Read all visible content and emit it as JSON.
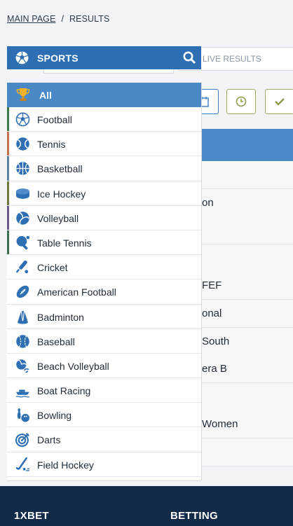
{
  "breadcrumb": {
    "home": "MAIN PAGE",
    "separator": "/",
    "current": "RESULTS"
  },
  "header": {
    "title": "SPORTS"
  },
  "search": {
    "placeholder": "LIVE RESULTS"
  },
  "menu": {
    "all_label": "All",
    "items": [
      {
        "label": "Football",
        "icon": "football-icon",
        "accent": "#3b7a4a"
      },
      {
        "label": "Tennis",
        "icon": "tennis-ball-icon",
        "accent": "#c0704a"
      },
      {
        "label": "Basketball",
        "icon": "basketball-icon",
        "accent": "#5b7f9e"
      },
      {
        "label": "Ice Hockey",
        "icon": "hockey-puck-icon",
        "accent": "#6b7a3c"
      },
      {
        "label": "Volleyball",
        "icon": "volleyball-icon",
        "accent": "#6a5a8e"
      },
      {
        "label": "Table Tennis",
        "icon": "table-tennis-icon",
        "accent": "#3d6e4e"
      },
      {
        "label": "Cricket",
        "icon": "cricket-bat-icon",
        "accent": ""
      },
      {
        "label": "American Football",
        "icon": "american-football-icon",
        "accent": ""
      },
      {
        "label": "Badminton",
        "icon": "shuttlecock-icon",
        "accent": ""
      },
      {
        "label": "Baseball",
        "icon": "baseball-icon",
        "accent": ""
      },
      {
        "label": "Beach Volleyball",
        "icon": "beach-volleyball-icon",
        "accent": ""
      },
      {
        "label": "Boat Racing",
        "icon": "boat-icon",
        "accent": ""
      },
      {
        "label": "Bowling",
        "icon": "bowling-icon",
        "accent": ""
      },
      {
        "label": "Darts",
        "icon": "darts-icon",
        "accent": ""
      },
      {
        "label": "Field Hockey",
        "icon": "field-hockey-icon",
        "accent": ""
      }
    ]
  },
  "background_rows": [
    {
      "text": ""
    },
    {
      "text": "on"
    },
    {
      "text": ""
    },
    {
      "text": ""
    },
    {
      "text": "FEF"
    },
    {
      "text": "onal"
    },
    {
      "text": " South"
    },
    {
      "text": "era B"
    },
    {
      "text": ""
    },
    {
      "text": " Women"
    },
    {
      "text": ""
    }
  ],
  "footer": {
    "col1": "1XBET",
    "col2": "BETTING"
  },
  "colors": {
    "header_blue": "#2e6fb3",
    "all_row_blue": "#4a88c6",
    "footer_navy": "#102a47",
    "icon_blue": "#2e6fb3"
  }
}
